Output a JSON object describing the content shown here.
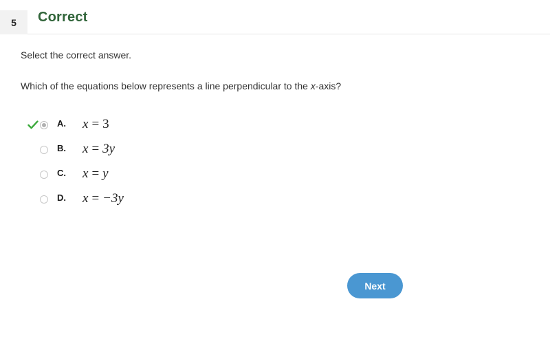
{
  "header": {
    "question_number": "5",
    "status_label": "Correct",
    "status_color": "#31653a",
    "badge_background": "#f2f2f2"
  },
  "question": {
    "instruction": "Select the correct answer.",
    "prompt_before_italic": "Which of the equations below represents a line perpendicular to the ",
    "prompt_italic": "x",
    "prompt_after_italic": "-axis?"
  },
  "options": [
    {
      "letter": "A.",
      "equation_lhs": "x",
      "equation_op": "=",
      "equation_rhs": "3",
      "selected": true,
      "correct": true,
      "check_icon": "check-icon"
    },
    {
      "letter": "B.",
      "equation_lhs": "x",
      "equation_op": "=",
      "equation_rhs": "3y",
      "selected": false,
      "correct": false,
      "check_icon": ""
    },
    {
      "letter": "C.",
      "equation_lhs": "x",
      "equation_op": "=",
      "equation_rhs": "y",
      "selected": false,
      "correct": false,
      "check_icon": ""
    },
    {
      "letter": "D.",
      "equation_lhs": "x",
      "equation_op": "=",
      "equation_rhs": "−3y",
      "selected": false,
      "correct": false,
      "check_icon": ""
    }
  ],
  "footer": {
    "next_label": "Next",
    "next_color": "#4a97d2"
  }
}
